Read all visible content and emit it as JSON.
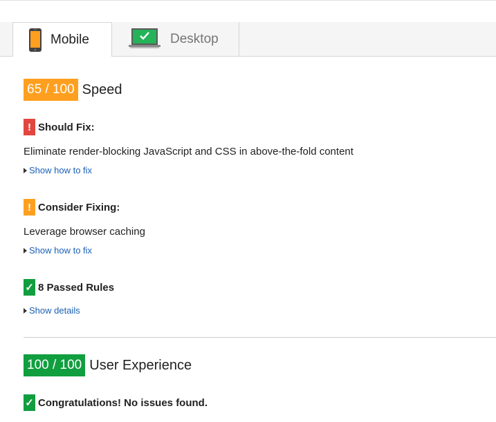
{
  "tabs": [
    {
      "label": "Mobile",
      "icon": "mobile-phone-icon",
      "active": true
    },
    {
      "label": "Desktop",
      "icon": "desktop-monitor-icon",
      "active": false
    }
  ],
  "speed": {
    "score": "65 / 100",
    "title": "Speed",
    "color": "#ff9f1f",
    "should_fix": {
      "heading": "Should Fix:",
      "badge": "!",
      "color": "#e2463f",
      "rule": "Eliminate render-blocking JavaScript and CSS in above-the-fold content",
      "link": "Show how to fix"
    },
    "consider_fixing": {
      "heading": "Consider Fixing:",
      "badge": "!",
      "color": "#ff9f1f",
      "rule": "Leverage browser caching",
      "link": "Show how to fix"
    },
    "passed": {
      "heading": "8 Passed Rules",
      "badge": "✓",
      "color": "#119e3f",
      "link": "Show details"
    }
  },
  "user_experience": {
    "score": "100 / 100",
    "title": "User Experience",
    "color": "#119e3f",
    "congrats": {
      "heading": "Congratulations! No issues found.",
      "badge": "✓",
      "color": "#119e3f"
    }
  }
}
